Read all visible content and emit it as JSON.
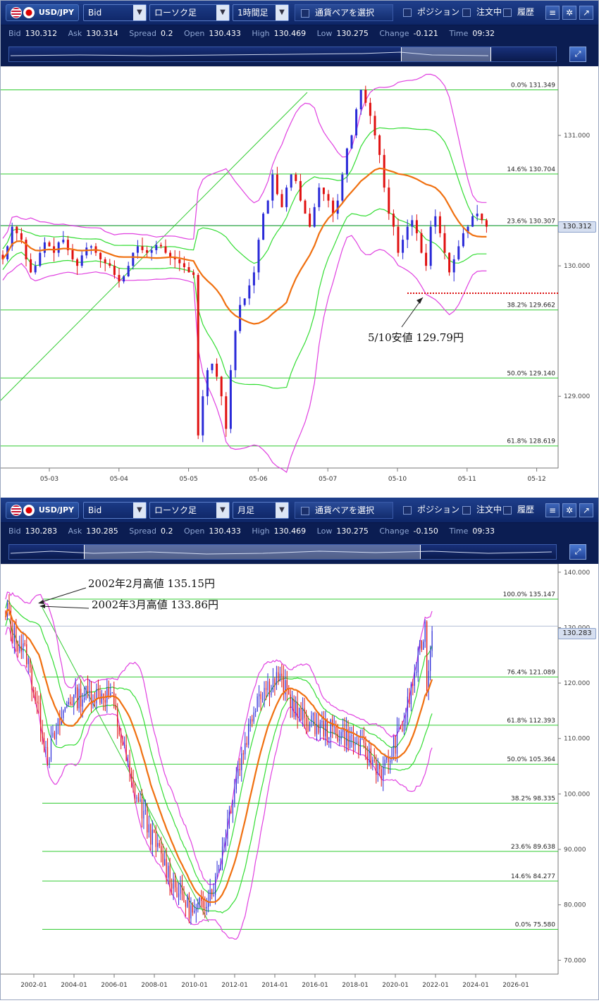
{
  "colors": {
    "up": "#2a2ad8",
    "down": "#e01010",
    "bb_outer": "#e040e0",
    "bb_inner": "#33dd33",
    "ma": "#f07010",
    "fib": "#33cc33",
    "support": "#dd1111"
  },
  "panels": [
    {
      "toolbar": {
        "pair": "USD/JPY",
        "price_type": "Bid",
        "chart_type": "ローソク足",
        "timeframe": "1時間足",
        "pair_select": "通貨ペアを選択",
        "position": "ポジション",
        "orders": "注文中",
        "history": "履歴"
      },
      "quote": {
        "bid_label": "Bid",
        "bid": "130.312",
        "ask_label": "Ask",
        "ask": "130.314",
        "spread_label": "Spread",
        "spread": "0.2",
        "open_label": "Open",
        "open": "130.433",
        "high_label": "High",
        "high": "130.469",
        "low_label": "Low",
        "low": "130.275",
        "change_label": "Change",
        "change": "-0.121",
        "time_label": "Time",
        "time": "09:32"
      },
      "current_price": "130.312",
      "annotation": "5/10安値 129.79円",
      "chart_data": {
        "type": "candlestick",
        "instrument": "USD/JPY",
        "timeframe": "1時間足",
        "x_ticks": [
          "05-03",
          "05-04",
          "05-05",
          "05-06",
          "05-07",
          "05-10",
          "05-11",
          "05-12"
        ],
        "y_ticks": [
          "131.000",
          "130.000",
          "129.000"
        ],
        "ylim": [
          128.45,
          131.53
        ],
        "fib_levels": [
          {
            "label": "0.0%",
            "value": 131.349
          },
          {
            "label": "14.6%",
            "value": 130.704
          },
          {
            "label": "23.6%",
            "value": 130.307
          },
          {
            "label": "38.2%",
            "value": 129.662
          },
          {
            "label": "50.0%",
            "value": 129.14
          },
          {
            "label": "61.8%",
            "value": 128.619
          }
        ],
        "support_line": 129.79,
        "closes": [
          130.05,
          130.15,
          130.3,
          130.25,
          130.2,
          130.05,
          129.95,
          130.0,
          130.1,
          130.18,
          130.15,
          130.1,
          130.18,
          130.2,
          130.12,
          130.05,
          130.0,
          130.08,
          130.14,
          130.15,
          130.1,
          130.05,
          130.02,
          130.0,
          129.93,
          129.88,
          129.92,
          130.0,
          130.1,
          130.15,
          130.12,
          130.1,
          130.12,
          130.16,
          130.15,
          130.1,
          130.06,
          130.05,
          130.02,
          129.99,
          129.95,
          129.93,
          128.7,
          129.0,
          129.2,
          129.25,
          129.15,
          129.0,
          128.75,
          129.2,
          129.5,
          129.7,
          129.75,
          129.85,
          129.95,
          130.2,
          130.4,
          130.5,
          130.7,
          130.55,
          130.45,
          130.6,
          130.7,
          130.65,
          130.5,
          130.4,
          130.3,
          130.45,
          130.6,
          130.55,
          130.5,
          130.4,
          130.5,
          130.7,
          130.9,
          131.0,
          131.2,
          131.35,
          131.25,
          131.15,
          131.0,
          130.85,
          130.6,
          130.4,
          130.3,
          130.1,
          130.2,
          130.3,
          130.35,
          130.25,
          130.1,
          130.0,
          130.3,
          130.38,
          130.25,
          130.1,
          129.95,
          130.05,
          130.15,
          130.25,
          130.3,
          130.38,
          130.4,
          130.35,
          130.3
        ],
        "bollinger": {
          "ma_color": "orange",
          "inner_color": "green",
          "outer_color": "magenta"
        }
      }
    },
    {
      "toolbar": {
        "pair": "USD/JPY",
        "price_type": "Bid",
        "chart_type": "ローソク足",
        "timeframe": "月足",
        "pair_select": "通貨ペアを選択",
        "position": "ポジション",
        "orders": "注文中",
        "history": "履歴"
      },
      "quote": {
        "bid_label": "Bid",
        "bid": "130.283",
        "ask_label": "Ask",
        "ask": "130.285",
        "spread_label": "Spread",
        "spread": "0.2",
        "open_label": "Open",
        "open": "130.433",
        "high_label": "High",
        "high": "130.469",
        "low_label": "Low",
        "low": "130.275",
        "change_label": "Change",
        "change": "-0.150",
        "time_label": "Time",
        "time": "09:33"
      },
      "current_price": "130.283",
      "annotation_1": "2002年2月高値 135.15円",
      "annotation_2": "2002年3月高値 133.86円",
      "chart_data": {
        "type": "candlestick",
        "instrument": "USD/JPY",
        "timeframe": "月足",
        "x_ticks": [
          "2002-01",
          "2004-01",
          "2006-01",
          "2008-01",
          "2010-01",
          "2012-01",
          "2014-01",
          "2016-01",
          "2018-01",
          "2020-01",
          "2022-01",
          "2024-01",
          "2026-01"
        ],
        "y_ticks": [
          "140.000",
          "130.000",
          "120.000",
          "110.000",
          "100.000",
          "90.000",
          "80.000",
          "70.000"
        ],
        "ylim": [
          67.5,
          141.5
        ],
        "fib_levels": [
          {
            "label": "100.0%",
            "value": 135.147
          },
          {
            "label": "76.4%",
            "value": 121.089
          },
          {
            "label": "61.8%",
            "value": 112.393
          },
          {
            "label": "50.0%",
            "value": 105.364
          },
          {
            "label": "38.2%",
            "value": 98.335
          },
          {
            "label": "23.6%",
            "value": 89.638
          },
          {
            "label": "14.6%",
            "value": 84.277
          },
          {
            "label": "0.0%",
            "value": 75.58
          }
        ],
        "year_anchors": {
          "2002": 131,
          "2003": 125,
          "2004": 107,
          "2005": 117,
          "2006": 118,
          "2007": 118,
          "2008": 102,
          "2009": 92,
          "2010": 84,
          "2011": 78,
          "2012": 84,
          "2013": 103,
          "2014": 118,
          "2015": 121,
          "2016": 114,
          "2017": 112,
          "2018": 111,
          "2019": 108,
          "2020": 104,
          "2021": 113,
          "2022": 130
        },
        "bollinger": {
          "ma_color": "orange",
          "inner_color": "green",
          "outer_color": "magenta"
        }
      }
    }
  ]
}
